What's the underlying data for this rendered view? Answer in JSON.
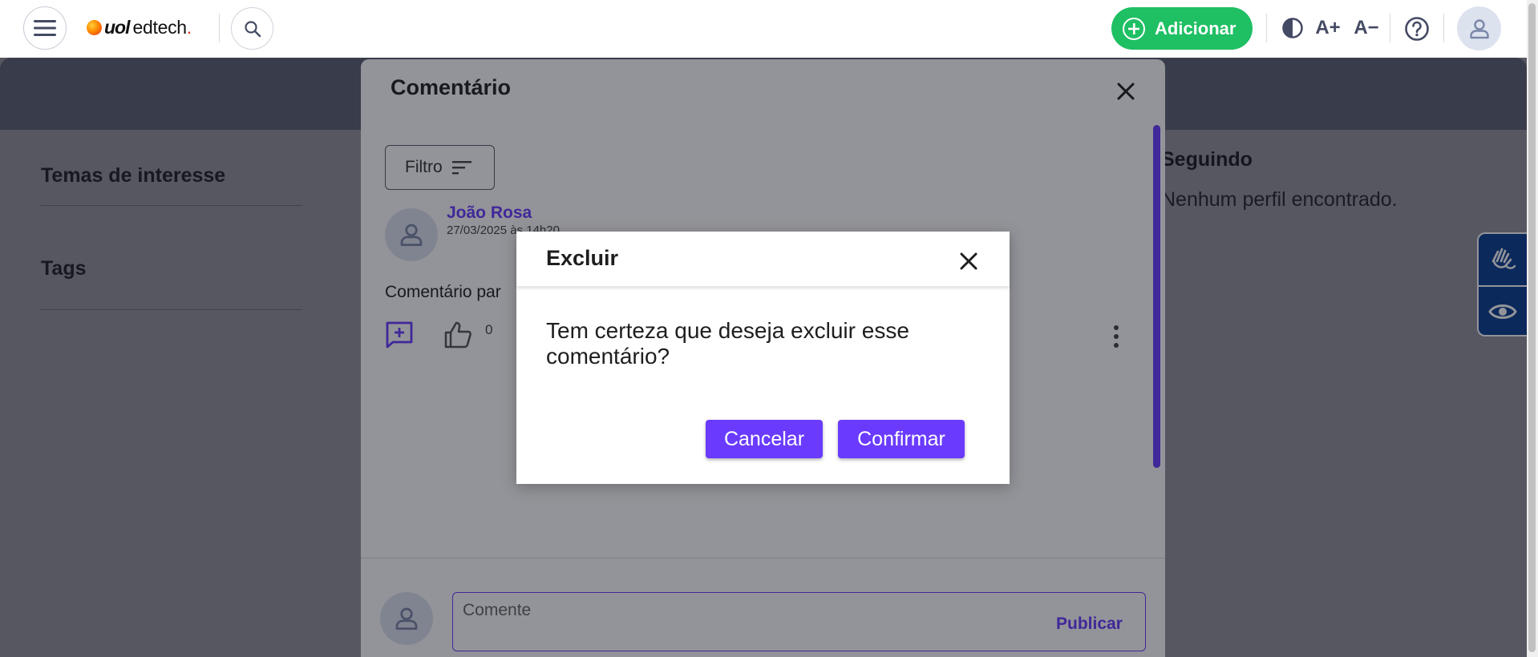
{
  "brand": {
    "logo_text": "uol",
    "logo_suffix": "edtech",
    "logo_underscore": "."
  },
  "header": {
    "add_label": "Adicionar",
    "font_increase": "A+",
    "font_decrease": "A−"
  },
  "sidebar": {
    "interests_title": "Temas de interesse",
    "tags_title": "Tags"
  },
  "following": {
    "title": "Seguindo",
    "empty_text": "Nenhum perfil encontrado."
  },
  "comment_modal": {
    "title": "Comentário",
    "filter_label": "Filtro",
    "comment": {
      "author": "João Rosa",
      "date": "27/03/2025 às 14h20",
      "text": "Comentário par",
      "likes": "0"
    },
    "input_placeholder": "Comente",
    "publish_label": "Publicar"
  },
  "delete_dialog": {
    "title": "Excluir",
    "message": "Tem certeza que deseja excluir esse comentário?",
    "cancel_label": "Cancelar",
    "confirm_label": "Confirmar"
  },
  "colors": {
    "brand_purple": "#6a3bff",
    "add_green": "#1fbf63",
    "a11y_blue": "#0a3c8f"
  }
}
